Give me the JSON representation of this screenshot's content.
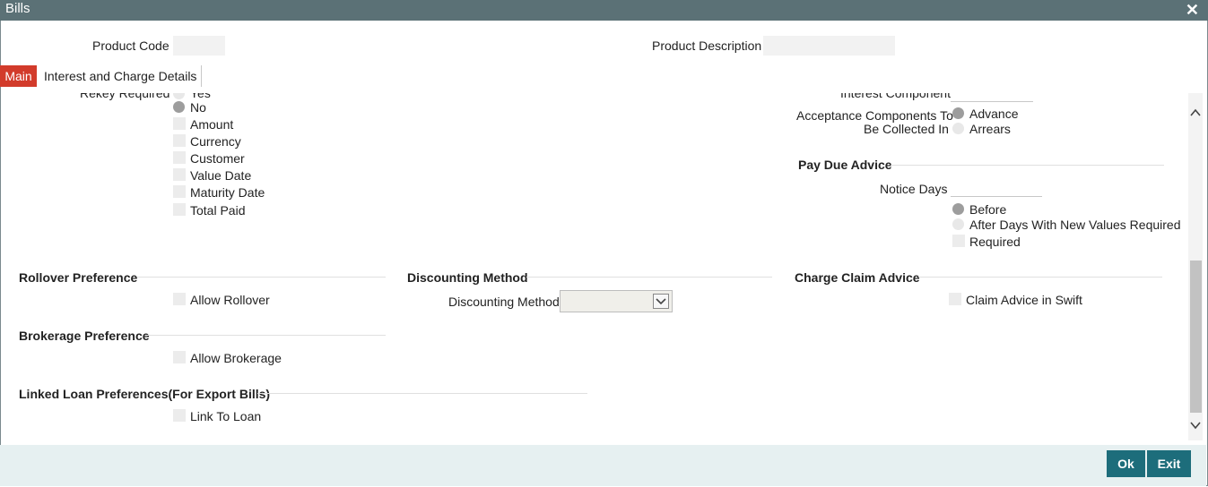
{
  "window": {
    "title": "Bills",
    "close_glyph": "✕"
  },
  "header": {
    "product_code_label": "Product Code",
    "product_code_value": "",
    "product_description_label": "Product Description",
    "product_description_value": ""
  },
  "tabs": [
    {
      "label": "Main",
      "active": true
    },
    {
      "label": "Interest and Charge Details",
      "active": false
    }
  ],
  "rekey": {
    "label": "Rekey Required",
    "yes_label": "Yes",
    "no_label": "No",
    "selected": "No",
    "options": [
      {
        "label": "Amount",
        "checked": false
      },
      {
        "label": "Currency",
        "checked": false
      },
      {
        "label": "Customer",
        "checked": false
      },
      {
        "label": "Value Date",
        "checked": false
      },
      {
        "label": "Maturity Date",
        "checked": false
      },
      {
        "label": "Total Paid",
        "checked": false
      }
    ]
  },
  "interest": {
    "interest_component_label": "Interest Component",
    "interest_component_value": "",
    "acceptance_label_line1": "Acceptance Components To",
    "acceptance_label_line2": "Be Collected In",
    "advance_label": "Advance",
    "arrears_label": "Arrears",
    "selected": "Advance"
  },
  "pay_due_advice": {
    "heading": "Pay Due Advice",
    "notice_days_label": "Notice Days",
    "notice_days_value": "",
    "before_label": "Before",
    "after_label": "After Days With New Values Required",
    "selected": "Before",
    "required_label": "Required",
    "required_checked": false
  },
  "rollover": {
    "heading": "Rollover Preference",
    "allow_label": "Allow Rollover",
    "checked": false
  },
  "discounting": {
    "heading": "Discounting Method",
    "field_label": "Discounting Method",
    "value": ""
  },
  "charge_claim": {
    "heading": "Charge Claim Advice",
    "claim_label": "Claim Advice in Swift",
    "checked": false
  },
  "brokerage": {
    "heading": "Brokerage Preference",
    "allow_label": "Allow Brokerage",
    "checked": false
  },
  "linked_loan": {
    "heading": "Linked Loan Preferences(For Export Bills)",
    "link_label": "Link To Loan",
    "checked": false
  },
  "footer": {
    "ok_label": "Ok",
    "exit_label": "Exit"
  },
  "colors": {
    "titlebar": "#5b7176",
    "tab_active": "#d23b2b",
    "button": "#1d6d7b",
    "footer": "#e6f0f1"
  }
}
